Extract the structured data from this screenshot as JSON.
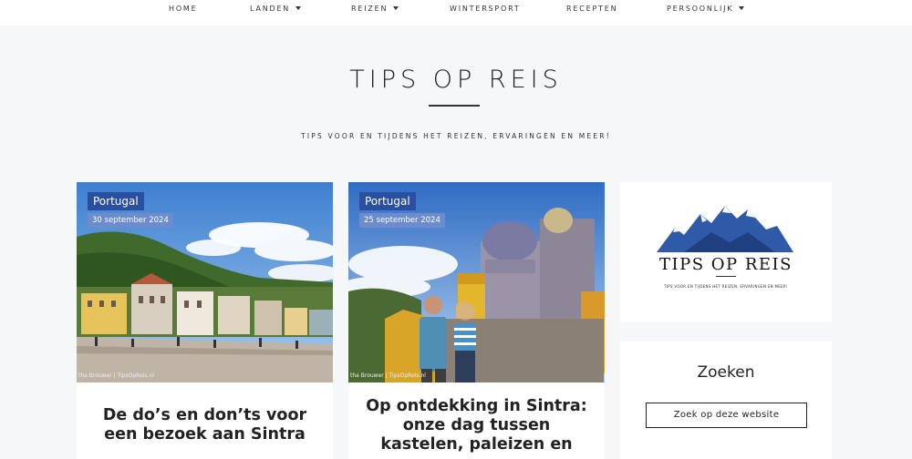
{
  "nav": {
    "items": [
      {
        "label": "HOME",
        "dropdown": false
      },
      {
        "label": "LANDEN",
        "dropdown": true
      },
      {
        "label": "REIZEN",
        "dropdown": true
      },
      {
        "label": "WINTERSPORT",
        "dropdown": false
      },
      {
        "label": "RECEPTEN",
        "dropdown": false
      },
      {
        "label": "PERSOONLIJK",
        "dropdown": true
      }
    ]
  },
  "header": {
    "title": "TIPS OP REIS",
    "tagline": "TIPS VOOR EN TIJDENS HET REIZEN, ERVARINGEN EN MEER!"
  },
  "posts": [
    {
      "category": "Portugal",
      "date": "30 september 2024",
      "title": "De do’s en don’ts voor een bezoek aan Sintra",
      "credit": "tha Brouwer | TipsOpReis.nl"
    },
    {
      "category": "Portugal",
      "date": "25 september 2024",
      "title": "Op ontdekking in Sintra: onze dag tussen kastelen, paleizen en meer",
      "credit": "tha Brouwer | TipsOpReis.nl"
    }
  ],
  "sidebar": {
    "logo": {
      "text": "TIPS OP REIS",
      "tagline": "TIPS VOOR EN TIJDENS HET REIZEN, ERVARINGEN EN MEER!"
    },
    "search": {
      "heading": "Zoeken",
      "button_label": "Zoek op deze website"
    }
  },
  "colors": {
    "category_badge": "#2b4fa0",
    "date_badge": "#6d8ccd",
    "page_background": "#f6f7f9"
  }
}
